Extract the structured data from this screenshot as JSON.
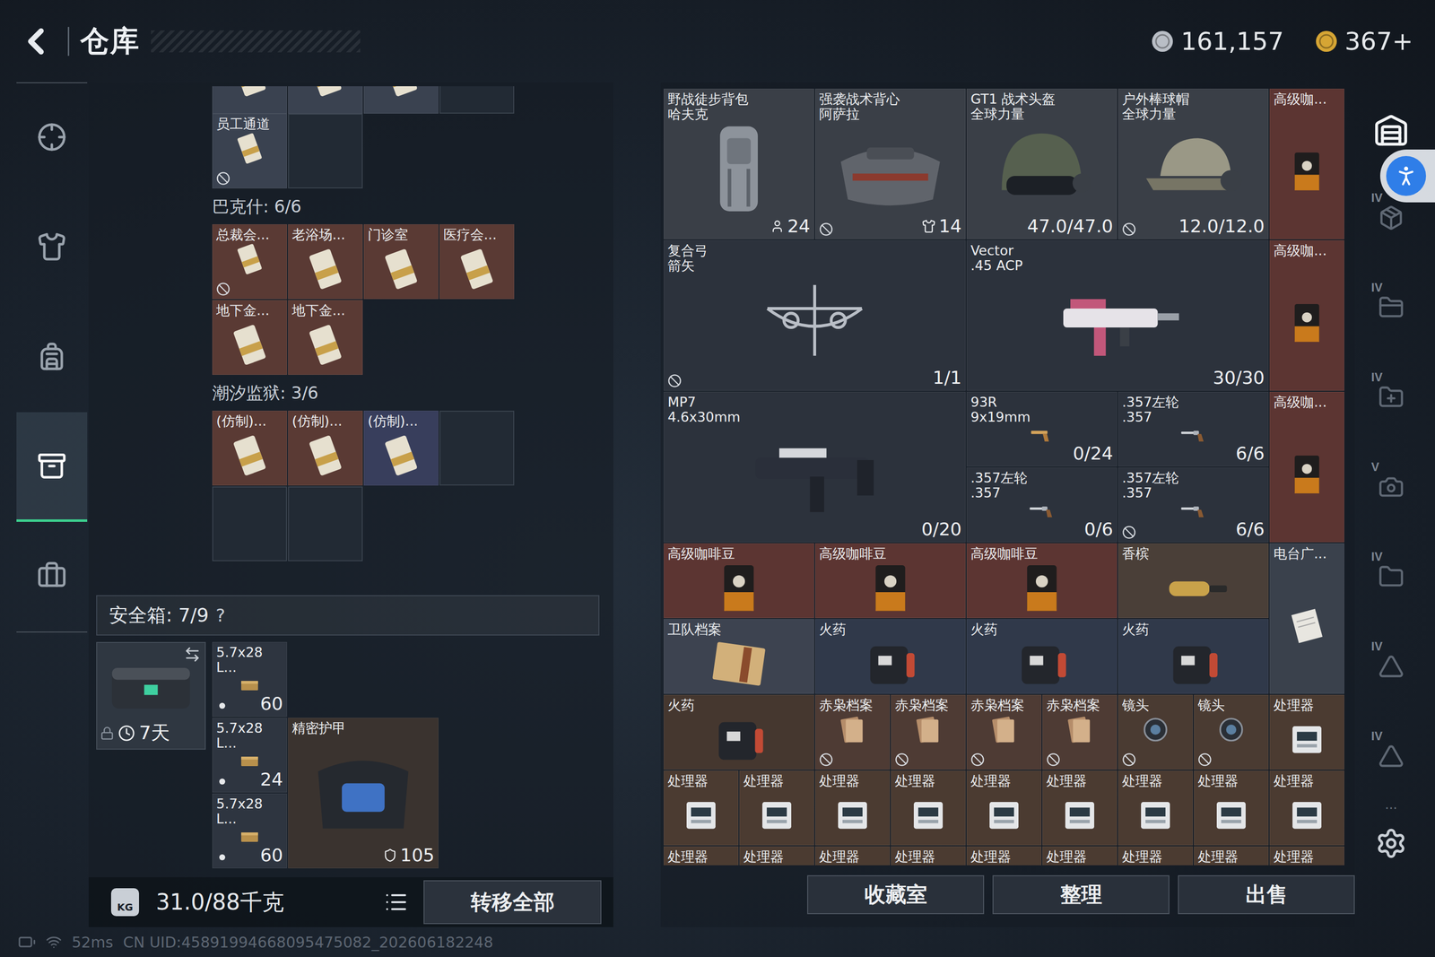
{
  "topbar": {
    "title": "仓库",
    "currencies": [
      {
        "value": "161,157",
        "color": "#b9bec6"
      },
      {
        "value": "367+",
        "color": "#d6a534"
      }
    ]
  },
  "nav": [
    {
      "selected": false
    },
    {
      "selected": false
    },
    {
      "selected": false
    },
    {
      "selected": true
    },
    {
      "selected": false
    }
  ],
  "key_holder": {
    "partial_row": [
      {
        "filled": true,
        "color": "#3a4250"
      },
      {
        "filled": true,
        "color": "#3a4250"
      },
      {
        "filled": true,
        "color": "#3a4250"
      },
      {
        "filled": false,
        "color": "#222a34"
      }
    ],
    "loose": [
      {
        "label": "员工通道",
        "filled": true,
        "no_trade": true,
        "color": "#3a4250"
      },
      {
        "filled": false,
        "no_trade": false,
        "color": "#222a34"
      }
    ],
    "groups": [
      {
        "title": "巴克什: 6/6",
        "slots": [
          {
            "label": "总裁会...",
            "filled": true,
            "no_trade": true,
            "color": "#5a3a34"
          },
          {
            "label": "老浴场...",
            "filled": true,
            "no_trade": false,
            "color": "#5a3a34"
          },
          {
            "label": "门诊室",
            "filled": true,
            "no_trade": false,
            "color": "#5a3a34"
          },
          {
            "label": "医疗会...",
            "filled": true,
            "no_trade": false,
            "color": "#5a3a34"
          },
          {
            "label": "地下金...",
            "filled": true,
            "no_trade": false,
            "color": "#5a3a34"
          },
          {
            "label": "地下金...",
            "filled": true,
            "no_trade": false,
            "color": "#5a3a34"
          }
        ]
      },
      {
        "title": "潮汐监狱: 3/6",
        "slots": [
          {
            "label": "(仿制)...",
            "filled": true,
            "no_trade": false,
            "color": "#5a3a34"
          },
          {
            "label": "(仿制)...",
            "filled": true,
            "no_trade": false,
            "color": "#5a3a34"
          },
          {
            "label": "(仿制)...",
            "filled": true,
            "no_trade": false,
            "color": "#383e5c"
          },
          {
            "filled": false,
            "no_trade": false,
            "color": "#222a34"
          },
          {
            "filled": false,
            "no_trade": false,
            "color": "#222a34"
          },
          {
            "filled": false,
            "no_trade": false,
            "color": "#222a34"
          }
        ]
      }
    ]
  },
  "safe": {
    "title": "安全箱: 7/9",
    "help": "?",
    "timer": "7天",
    "items": [
      {
        "label": [
          "5.7x28",
          "L..."
        ],
        "count": "60",
        "no_trade": false,
        "color": "#2e3540"
      },
      {
        "label": [
          "5.7x28",
          "L..."
        ],
        "count": "24",
        "no_trade": false,
        "color": "#2e3540"
      },
      {
        "label": [
          "5.7x28",
          "L..."
        ],
        "count": "60",
        "no_trade": false,
        "color": "#2e3540"
      },
      {
        "label": [
          "精密护甲"
        ],
        "count": "105",
        "no_trade": false,
        "color": "#3a332f"
      }
    ]
  },
  "bottom_bar": {
    "unit_icon": "KG",
    "weight": "31.0/88千克",
    "button": "转移全部"
  },
  "warehouse": {
    "items": [
      {
        "label": [
          "野战徒步背包",
          "哈夫克"
        ],
        "count": "24",
        "no_trade": false,
        "color": "#3a3f47"
      },
      {
        "label": [
          "强袭战术背心",
          "阿萨拉"
        ],
        "count": "14",
        "no_trade": true,
        "color": "#3a3f47"
      },
      {
        "label": [
          "GT1 战术头盔",
          "全球力量"
        ],
        "count": "47.0/47.0",
        "no_trade": false,
        "color": "#3a3f47"
      },
      {
        "label": [
          "户外棒球帽",
          "全球力量"
        ],
        "count": "12.0/12.0",
        "no_trade": true,
        "color": "#3a3f47"
      },
      {
        "label": [
          "高级咖..."
        ],
        "no_trade": false,
        "color": "#5c3532"
      },
      {
        "label": [
          "复合弓",
          "箭矢"
        ],
        "count": "1/1",
        "no_trade": true,
        "color": "#2c323c"
      },
      {
        "label": [
          "Vector",
          ".45 ACP"
        ],
        "count": "30/30",
        "no_trade": false,
        "color": "#2c323c"
      },
      {
        "label": [
          "高级咖..."
        ],
        "no_trade": false,
        "color": "#5c3532"
      },
      {
        "label": [
          "MP7",
          "4.6x30mm"
        ],
        "count": "0/20",
        "no_trade": false,
        "color": "#2c323c"
      },
      {
        "label": [
          "93R",
          "9x19mm"
        ],
        "count": "0/24",
        "no_trade": false,
        "color": "#2c323c"
      },
      {
        "label": [
          ".357左轮",
          ".357"
        ],
        "count": "6/6",
        "no_trade": false,
        "color": "#2c323c"
      },
      {
        "label": [
          ".357左轮",
          ".357"
        ],
        "count": "0/6",
        "no_trade": false,
        "color": "#2c323c"
      },
      {
        "label": [
          ".357左轮",
          ".357"
        ],
        "count": "6/6",
        "no_trade": true,
        "color": "#2c323c"
      },
      {
        "label": [
          "高级咖..."
        ],
        "no_trade": false,
        "color": "#5c3532"
      },
      {
        "label": [
          "高级咖啡豆"
        ],
        "no_trade": false,
        "color": "#5c3532"
      },
      {
        "label": [
          "高级咖啡豆"
        ],
        "no_trade": false,
        "color": "#5c3532"
      },
      {
        "label": [
          "高级咖啡豆"
        ],
        "no_trade": false,
        "color": "#5c3532"
      },
      {
        "label": [
          "香槟"
        ],
        "no_trade": false,
        "color": "#4a3f38"
      },
      {
        "label": [
          "电台广..."
        ],
        "no_trade": false,
        "color": "#3a414c"
      },
      {
        "label": [
          "卫队档案"
        ],
        "no_trade": false,
        "color": "#3d4350"
      },
      {
        "label": [
          "火药"
        ],
        "no_trade": false,
        "color": "#30394a"
      },
      {
        "label": [
          "火药"
        ],
        "no_trade": false,
        "color": "#30394a"
      },
      {
        "label": [
          "火药"
        ],
        "no_trade": false,
        "color": "#30394a"
      },
      {
        "label": [
          "火药"
        ],
        "no_trade": false,
        "color": "#45372f"
      },
      {
        "label": [
          "赤枭档案"
        ],
        "no_trade": true,
        "color": "#4e3b34"
      },
      {
        "label": [
          "赤枭档案"
        ],
        "no_trade": true,
        "color": "#4e3b34"
      },
      {
        "label": [
          "赤枭档案"
        ],
        "no_trade": true,
        "color": "#4e3b34"
      },
      {
        "label": [
          "赤枭档案"
        ],
        "no_trade": true,
        "color": "#4e3b34"
      },
      {
        "label": [
          "镜头"
        ],
        "no_trade": true,
        "color": "#4a3b32"
      },
      {
        "label": [
          "镜头"
        ],
        "no_trade": true,
        "color": "#4a3b32"
      },
      {
        "label": [
          "处理器"
        ],
        "no_trade": false,
        "color": "#4b3b31"
      },
      {
        "label": [
          "处理器"
        ],
        "no_trade": false,
        "color": "#4b3b31"
      },
      {
        "label": [
          "处理器"
        ],
        "no_trade": false,
        "color": "#4b3b31"
      },
      {
        "label": [
          "处理器"
        ],
        "no_trade": false,
        "color": "#4b3b31"
      },
      {
        "label": [
          "处理器"
        ],
        "no_trade": false,
        "color": "#4b3b31"
      },
      {
        "label": [
          "处理器"
        ],
        "no_trade": false,
        "color": "#4b3b31"
      },
      {
        "label": [
          "处理器"
        ],
        "no_trade": false,
        "color": "#4b3b31"
      },
      {
        "label": [
          "处理器"
        ],
        "no_trade": false,
        "color": "#4b3b31"
      },
      {
        "label": [
          "处理器"
        ],
        "no_trade": false,
        "color": "#4b3b31"
      },
      {
        "label": [
          "处理器"
        ],
        "no_trade": false,
        "color": "#4b3b31"
      },
      {
        "label": [
          "处理器"
        ],
        "no_trade": false,
        "color": "#4b3b31"
      },
      {
        "label": [
          "处理器"
        ],
        "no_trade": false,
        "color": "#4b3b31"
      },
      {
        "label": [
          "处理器"
        ],
        "no_trade": false,
        "color": "#4b3b31"
      },
      {
        "label": [
          "处理器"
        ],
        "no_trade": false,
        "color": "#4b3b31"
      },
      {
        "label": [
          "处理器"
        ],
        "no_trade": false,
        "color": "#4b3b31"
      },
      {
        "label": [
          "处理器"
        ],
        "no_trade": false,
        "color": "#4b3b31"
      },
      {
        "label": [
          "处理器"
        ],
        "no_trade": false,
        "color": "#4b3b31"
      },
      {
        "label": [
          "处理器"
        ],
        "no_trade": false,
        "color": "#4b3b31"
      },
      {
        "label": [
          "处理器"
        ],
        "no_trade": false,
        "color": "#4b3b31"
      }
    ],
    "actions": [
      "收藏室",
      "整理",
      "出售"
    ]
  },
  "rail": {
    "tiers": [
      "IV",
      "IV",
      "IV",
      "V",
      "IV",
      "IV",
      "IV"
    ],
    "more": "..."
  },
  "status_bar": {
    "ping": "52ms",
    "uid": "CN UID:45891994668095475082_202606182248"
  }
}
